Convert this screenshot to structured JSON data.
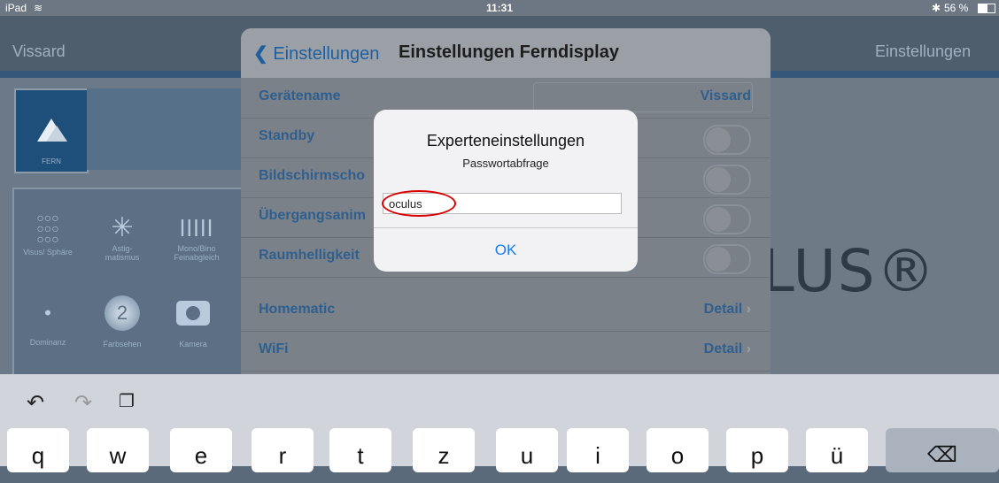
{
  "status_bar": {
    "device": "iPad",
    "wifi_icon": "wifi-icon",
    "time": "11:31",
    "bluetooth": "✱",
    "battery": "56 %"
  },
  "app_nav": {
    "left_title": "Vissard",
    "right_title": "Einstellungen"
  },
  "left_panel": {
    "fern_label": "FERN",
    "tools": [
      {
        "label": "Visus/ Sphäre",
        "icon": "circles-grid-icon"
      },
      {
        "label": "Astig-\nmatismus",
        "icon": "astigmatism-icon"
      },
      {
        "label": "Mono/Bino\nFeinabgleich",
        "icon": "bars-icon"
      },
      {
        "label": "Dominanz",
        "icon": "dot-icon"
      },
      {
        "label": "Farbsehen",
        "icon": "color-plate-icon"
      },
      {
        "label": "Kamera",
        "icon": "camera-icon"
      }
    ]
  },
  "brand": {
    "text": "LUS®"
  },
  "settings": {
    "back_label": "Einstellungen",
    "title": "Einstellungen Ferndisplay",
    "rows": [
      {
        "label": "Gerätename",
        "value": "Vissard"
      },
      {
        "label": "Standby"
      },
      {
        "label": "Bildschirmscho"
      },
      {
        "label": "Übergangsanim"
      },
      {
        "label": "Raumhelligkeit"
      },
      {
        "label": "Homematic",
        "value": "Detail"
      },
      {
        "label": "WiFi",
        "value": "Detail"
      }
    ]
  },
  "dialog": {
    "title": "Experteneinstellungen",
    "message": "Passwortabfrage",
    "input_value": "oculus",
    "ok_label": "OK"
  },
  "keyboard": {
    "keys": [
      "q",
      "w",
      "e",
      "r",
      "t",
      "z",
      "u",
      "i",
      "o",
      "p",
      "ü"
    ],
    "delete_icon": "delete-icon"
  }
}
